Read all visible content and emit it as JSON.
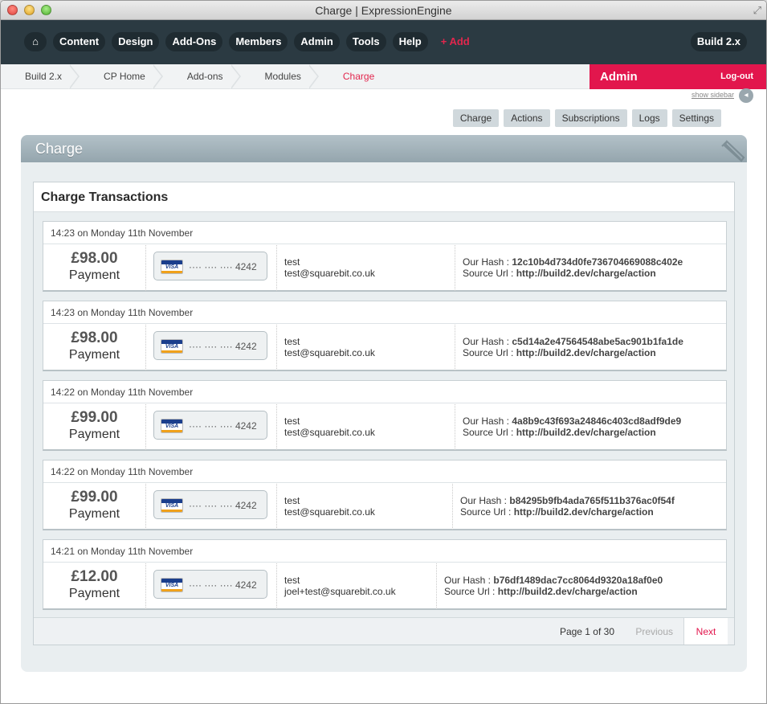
{
  "window": {
    "title": "Charge | ExpressionEngine"
  },
  "nav": {
    "items": [
      "Content",
      "Design",
      "Add-Ons",
      "Members",
      "Admin",
      "Tools",
      "Help"
    ],
    "add_label": "+ Add",
    "build_label": "Build 2.x"
  },
  "breadcrumb": [
    "Build 2.x",
    "CP Home",
    "Add-ons",
    "Modules"
  ],
  "breadcrumb_current": "Charge",
  "admin": {
    "title": "Admin",
    "logout": "Log-out"
  },
  "sidebar_toggle": "show sidebar",
  "subtabs": [
    "Charge",
    "Actions",
    "Subscriptions",
    "Logs",
    "Settings"
  ],
  "panel": {
    "title": "Charge",
    "box_title": "Charge Transactions"
  },
  "transactions": [
    {
      "date": "14:23 on Monday 11th November",
      "amount": "£98.00",
      "type": "Payment",
      "card": "···· ···· ···· 4242",
      "name": "test",
      "email": "test@squarebit.co.uk",
      "hash_label": "Our Hash : ",
      "hash": "12c10b4d734d0fe736704669088c402e",
      "url_label": "Source Url : ",
      "url": "http://build2.dev/charge/action"
    },
    {
      "date": "14:23 on Monday 11th November",
      "amount": "£98.00",
      "type": "Payment",
      "card": "···· ···· ···· 4242",
      "name": "test",
      "email": "test@squarebit.co.uk",
      "hash_label": "Our Hash : ",
      "hash": "c5d14a2e47564548abe5ac901b1fa1de",
      "url_label": "Source Url : ",
      "url": "http://build2.dev/charge/action"
    },
    {
      "date": "14:22 on Monday 11th November",
      "amount": "£99.00",
      "type": "Payment",
      "card": "···· ···· ···· 4242",
      "name": "test",
      "email": "test@squarebit.co.uk",
      "hash_label": "Our Hash : ",
      "hash": "4a8b9c43f693a24846c403cd8adf9de9",
      "url_label": "Source Url : ",
      "url": "http://build2.dev/charge/action"
    },
    {
      "date": "14:22 on Monday 11th November",
      "amount": "£99.00",
      "type": "Payment",
      "card": "···· ···· ···· 4242",
      "name": "test",
      "email": "test@squarebit.co.uk",
      "hash_label": "Our Hash : ",
      "hash": "b84295b9fb4ada765f511b376ac0f54f",
      "url_label": "Source Url : ",
      "url": "http://build2.dev/charge/action"
    },
    {
      "date": "14:21 on Monday 11th November",
      "amount": "£12.00",
      "type": "Payment",
      "card": "···· ···· ···· 4242",
      "name": "test",
      "email": "joel+test@squarebit.co.uk",
      "hash_label": "Our Hash : ",
      "hash": "b76df1489dac7cc8064d9320a18af0e0",
      "url_label": "Source Url : ",
      "url": "http://build2.dev/charge/action"
    }
  ],
  "card_brand": "VISA",
  "pager": {
    "info": "Page 1 of 30",
    "previous": "Previous",
    "next": "Next"
  },
  "colors": {
    "accent": "#e2164d",
    "nav_bg": "#2b3a42",
    "panel_header": "#a3b3ba"
  }
}
